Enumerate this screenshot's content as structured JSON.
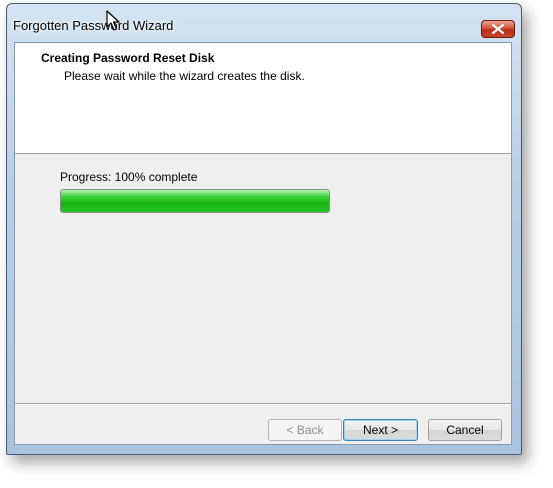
{
  "window": {
    "title": "Forgotten Password Wizard"
  },
  "header": {
    "title": "Creating Password Reset Disk",
    "subtitle": "Please wait while the wizard creates the disk."
  },
  "progress": {
    "label": "Progress: 100% complete",
    "value": 1.0,
    "fill_color": "#22bb22"
  },
  "buttons": {
    "back_label": "< Back",
    "back_enabled": false,
    "next_label": "Next >",
    "cancel_label": "Cancel"
  },
  "icons": {
    "close": "close-icon",
    "cursor": "mouse-pointer-icon"
  }
}
